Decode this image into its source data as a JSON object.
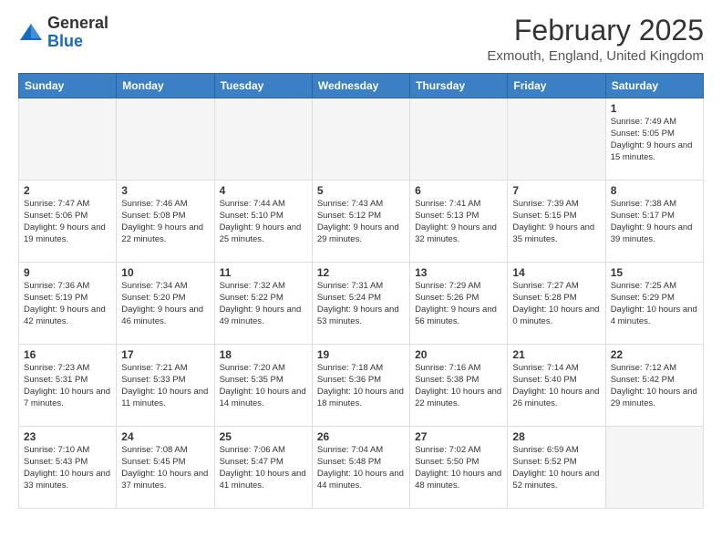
{
  "header": {
    "logo_line1": "General",
    "logo_line2": "Blue",
    "main_title": "February 2025",
    "sub_title": "Exmouth, England, United Kingdom"
  },
  "weekdays": [
    "Sunday",
    "Monday",
    "Tuesday",
    "Wednesday",
    "Thursday",
    "Friday",
    "Saturday"
  ],
  "weeks": [
    [
      {
        "day": "",
        "info": ""
      },
      {
        "day": "",
        "info": ""
      },
      {
        "day": "",
        "info": ""
      },
      {
        "day": "",
        "info": ""
      },
      {
        "day": "",
        "info": ""
      },
      {
        "day": "",
        "info": ""
      },
      {
        "day": "1",
        "info": "Sunrise: 7:49 AM\nSunset: 5:05 PM\nDaylight: 9 hours and 15 minutes."
      }
    ],
    [
      {
        "day": "2",
        "info": "Sunrise: 7:47 AM\nSunset: 5:06 PM\nDaylight: 9 hours and 19 minutes."
      },
      {
        "day": "3",
        "info": "Sunrise: 7:46 AM\nSunset: 5:08 PM\nDaylight: 9 hours and 22 minutes."
      },
      {
        "day": "4",
        "info": "Sunrise: 7:44 AM\nSunset: 5:10 PM\nDaylight: 9 hours and 25 minutes."
      },
      {
        "day": "5",
        "info": "Sunrise: 7:43 AM\nSunset: 5:12 PM\nDaylight: 9 hours and 29 minutes."
      },
      {
        "day": "6",
        "info": "Sunrise: 7:41 AM\nSunset: 5:13 PM\nDaylight: 9 hours and 32 minutes."
      },
      {
        "day": "7",
        "info": "Sunrise: 7:39 AM\nSunset: 5:15 PM\nDaylight: 9 hours and 35 minutes."
      },
      {
        "day": "8",
        "info": "Sunrise: 7:38 AM\nSunset: 5:17 PM\nDaylight: 9 hours and 39 minutes."
      }
    ],
    [
      {
        "day": "9",
        "info": "Sunrise: 7:36 AM\nSunset: 5:19 PM\nDaylight: 9 hours and 42 minutes."
      },
      {
        "day": "10",
        "info": "Sunrise: 7:34 AM\nSunset: 5:20 PM\nDaylight: 9 hours and 46 minutes."
      },
      {
        "day": "11",
        "info": "Sunrise: 7:32 AM\nSunset: 5:22 PM\nDaylight: 9 hours and 49 minutes."
      },
      {
        "day": "12",
        "info": "Sunrise: 7:31 AM\nSunset: 5:24 PM\nDaylight: 9 hours and 53 minutes."
      },
      {
        "day": "13",
        "info": "Sunrise: 7:29 AM\nSunset: 5:26 PM\nDaylight: 9 hours and 56 minutes."
      },
      {
        "day": "14",
        "info": "Sunrise: 7:27 AM\nSunset: 5:28 PM\nDaylight: 10 hours and 0 minutes."
      },
      {
        "day": "15",
        "info": "Sunrise: 7:25 AM\nSunset: 5:29 PM\nDaylight: 10 hours and 4 minutes."
      }
    ],
    [
      {
        "day": "16",
        "info": "Sunrise: 7:23 AM\nSunset: 5:31 PM\nDaylight: 10 hours and 7 minutes."
      },
      {
        "day": "17",
        "info": "Sunrise: 7:21 AM\nSunset: 5:33 PM\nDaylight: 10 hours and 11 minutes."
      },
      {
        "day": "18",
        "info": "Sunrise: 7:20 AM\nSunset: 5:35 PM\nDaylight: 10 hours and 14 minutes."
      },
      {
        "day": "19",
        "info": "Sunrise: 7:18 AM\nSunset: 5:36 PM\nDaylight: 10 hours and 18 minutes."
      },
      {
        "day": "20",
        "info": "Sunrise: 7:16 AM\nSunset: 5:38 PM\nDaylight: 10 hours and 22 minutes."
      },
      {
        "day": "21",
        "info": "Sunrise: 7:14 AM\nSunset: 5:40 PM\nDaylight: 10 hours and 26 minutes."
      },
      {
        "day": "22",
        "info": "Sunrise: 7:12 AM\nSunset: 5:42 PM\nDaylight: 10 hours and 29 minutes."
      }
    ],
    [
      {
        "day": "23",
        "info": "Sunrise: 7:10 AM\nSunset: 5:43 PM\nDaylight: 10 hours and 33 minutes."
      },
      {
        "day": "24",
        "info": "Sunrise: 7:08 AM\nSunset: 5:45 PM\nDaylight: 10 hours and 37 minutes."
      },
      {
        "day": "25",
        "info": "Sunrise: 7:06 AM\nSunset: 5:47 PM\nDaylight: 10 hours and 41 minutes."
      },
      {
        "day": "26",
        "info": "Sunrise: 7:04 AM\nSunset: 5:48 PM\nDaylight: 10 hours and 44 minutes."
      },
      {
        "day": "27",
        "info": "Sunrise: 7:02 AM\nSunset: 5:50 PM\nDaylight: 10 hours and 48 minutes."
      },
      {
        "day": "28",
        "info": "Sunrise: 6:59 AM\nSunset: 5:52 PM\nDaylight: 10 hours and 52 minutes."
      },
      {
        "day": "",
        "info": ""
      }
    ]
  ]
}
